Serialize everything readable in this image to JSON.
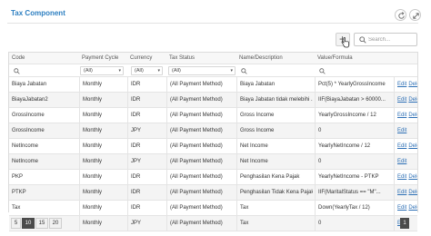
{
  "panel": {
    "title": "Tax Component"
  },
  "toolbar": {
    "add_label": "+",
    "search_placeholder": "Search..."
  },
  "columns": [
    "Code",
    "Payment Cycle",
    "Currency",
    "Tax Status",
    "Name/Description",
    "Value/Formula"
  ],
  "filters": {
    "payment_cycle": "(All)",
    "currency": "(All)",
    "tax_status": "(All)"
  },
  "actions": {
    "edit": "Edit",
    "delete": "Delete"
  },
  "rows": [
    {
      "code": "Biaya Jabatan",
      "cycle": "Monthly",
      "currency": "IDR",
      "status": "(All Payment Method)",
      "name": "Biaya Jabatan",
      "value": "Pct(5) * YearlyGrossIncome",
      "deletable": true
    },
    {
      "code": "BiayaJabatan2",
      "cycle": "Monthly",
      "currency": "IDR",
      "status": "(All Payment Method)",
      "name": "Biaya Jabatan tidak melebihi ...",
      "value": "IIF(BiayaJabatan > 60000...",
      "deletable": true
    },
    {
      "code": "GrossIncome",
      "cycle": "Monthly",
      "currency": "IDR",
      "status": "(All Payment Method)",
      "name": "Gross Income",
      "value": "YearlyGrossIncome / 12",
      "deletable": true
    },
    {
      "code": "GrossIncome",
      "cycle": "Monthly",
      "currency": "JPY",
      "status": "(All Payment Method)",
      "name": "Gross Income",
      "value": "0",
      "deletable": false
    },
    {
      "code": "NetIncome",
      "cycle": "Monthly",
      "currency": "IDR",
      "status": "(All Payment Method)",
      "name": "Net Income",
      "value": "YearlyNetIncome / 12",
      "deletable": true
    },
    {
      "code": "NetIncome",
      "cycle": "Monthly",
      "currency": "JPY",
      "status": "(All Payment Method)",
      "name": "Net Income",
      "value": "0",
      "deletable": false
    },
    {
      "code": "PKP",
      "cycle": "Monthly",
      "currency": "IDR",
      "status": "(All Payment Method)",
      "name": "Penghasilan Kena Pajak",
      "value": "YearlyNetIncome - PTKP",
      "deletable": true
    },
    {
      "code": "PTKP",
      "cycle": "Monthly",
      "currency": "IDR",
      "status": "(All Payment Method)",
      "name": "Penghasilan Tidak Kena Pajak",
      "value": "IIF(MaritalStatus == \"M\"...",
      "deletable": true
    },
    {
      "code": "Tax",
      "cycle": "Monthly",
      "currency": "IDR",
      "status": "(All Payment Method)",
      "name": "Tax",
      "value": "Down(YearlyTax / 12)",
      "deletable": true
    },
    {
      "code": "Tax",
      "cycle": "Monthly",
      "currency": "JPY",
      "status": "(All Payment Method)",
      "name": "Tax",
      "value": "0",
      "deletable": false
    }
  ],
  "pager": {
    "sizes": [
      "5",
      "10",
      "15",
      "20"
    ],
    "active_size": "10",
    "pages": [
      "1"
    ],
    "active_page": "1"
  }
}
